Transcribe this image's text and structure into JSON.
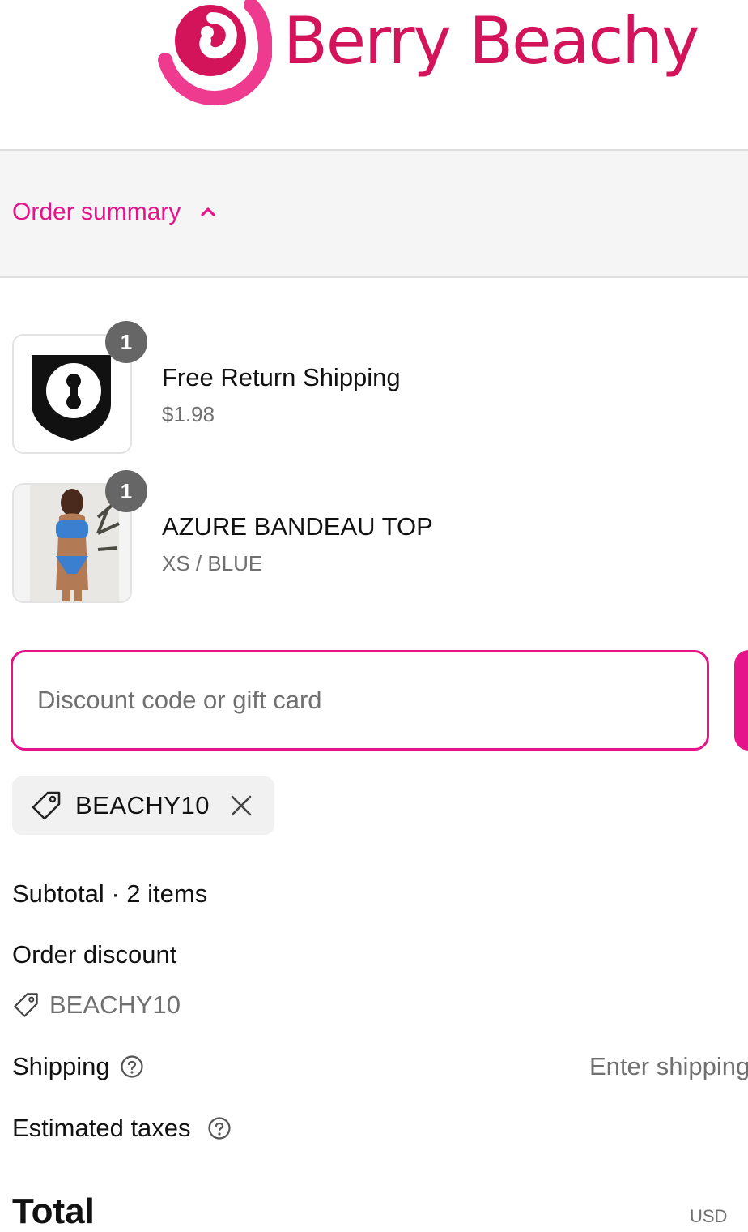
{
  "brand": {
    "name": "Berry Beachy",
    "accent": "#e5148a",
    "logo_color": "#d4145a"
  },
  "summary": {
    "toggle_label": "Order summary",
    "icon": "chevron-up-icon"
  },
  "items": [
    {
      "title": "Free Return Shipping",
      "subtitle": "$1.98",
      "quantity": "1",
      "thumb_icon": "shield-keyhole-icon"
    },
    {
      "title": "AZURE BANDEAU TOP",
      "subtitle": "XS / BLUE",
      "quantity": "1",
      "thumb_icon": "product-photo"
    }
  ],
  "discount": {
    "placeholder": "Discount code or gift card",
    "applied_code": "BEACHY10",
    "tag_icon": "tag-icon",
    "remove_icon": "close-icon"
  },
  "totals": {
    "subtotal_label": "Subtotal · 2 items",
    "order_discount_label": "Order discount",
    "order_discount_code": "BEACHY10",
    "shipping_label": "Shipping",
    "shipping_value": "Enter shipping",
    "taxes_label": "Estimated taxes",
    "help_icon": "help-circle-icon",
    "total_label": "Total",
    "currency": "USD"
  }
}
